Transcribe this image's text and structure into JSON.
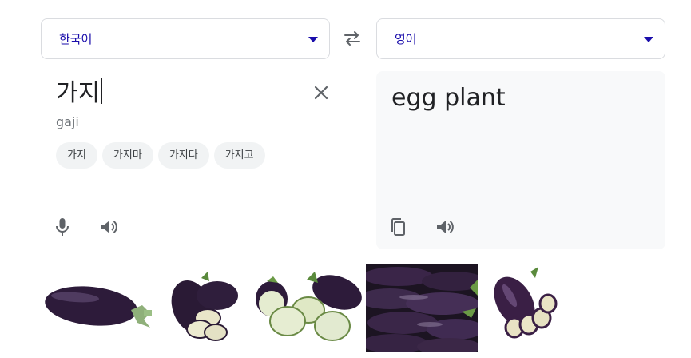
{
  "source": {
    "language": "한국어",
    "text": "가지",
    "romanization": "gaji",
    "suggestions": [
      "가지",
      "가지마",
      "가지다",
      "가지고"
    ]
  },
  "target": {
    "language": "영어",
    "text": "egg plant"
  },
  "icons": {
    "swap": "swap-icon",
    "clear": "close-icon",
    "mic": "mic-icon",
    "listen": "speaker-icon",
    "copy": "copy-icon"
  },
  "colors": {
    "accent": "#1a0dab",
    "icon_gray": "#5f6368",
    "target_panel_bg": "#f8f9fa",
    "chip_bg": "#f1f3f4",
    "eggplant_purple": "#2d1b3a"
  },
  "images": [
    {
      "name": "eggplant-image-1"
    },
    {
      "name": "eggplant-image-2"
    },
    {
      "name": "eggplant-image-3"
    },
    {
      "name": "eggplant-image-4"
    },
    {
      "name": "eggplant-image-5"
    }
  ]
}
